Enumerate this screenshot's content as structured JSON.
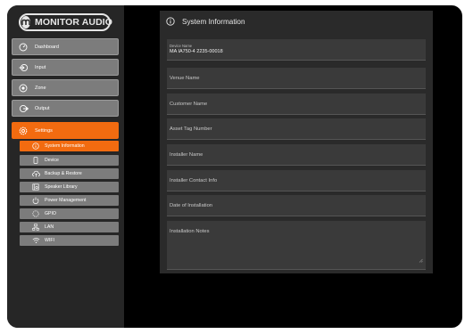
{
  "brand": {
    "name": "MONITOR AUDIO"
  },
  "nav": [
    {
      "label": "Dashboard",
      "icon": "dashboard-icon",
      "active": false
    },
    {
      "label": "Input",
      "icon": "input-icon",
      "active": false
    },
    {
      "label": "Zone",
      "icon": "zone-icon",
      "active": false
    },
    {
      "label": "Output",
      "icon": "output-icon",
      "active": false
    },
    {
      "label": "Settings",
      "icon": "gear-icon",
      "active": true
    }
  ],
  "settings_sub": [
    {
      "label": "System Information",
      "icon": "info-icon",
      "active": true
    },
    {
      "label": "Device",
      "icon": "device-icon",
      "active": false
    },
    {
      "label": "Backup & Restore",
      "icon": "cloud-icon",
      "active": false
    },
    {
      "label": "Speaker Library",
      "icon": "library-icon",
      "active": false
    },
    {
      "label": "Power Management",
      "icon": "power-icon",
      "active": false
    },
    {
      "label": "GPIO",
      "icon": "gpio-icon",
      "active": false
    },
    {
      "label": "LAN",
      "icon": "lan-icon",
      "active": false
    },
    {
      "label": "WIFI",
      "icon": "wifi-icon",
      "active": false
    }
  ],
  "panel": {
    "title": "System Information",
    "device_name_label": "Device Name",
    "device_name_value": "MA IA750-4 2235-00018",
    "fields": [
      "Venue Name",
      "Customer Name",
      "Asset Tag Number",
      "Installer Name",
      "Installer Contact Info",
      "Date of Installation"
    ],
    "notes_placeholder": "Installation Notes"
  },
  "colors": {
    "accent": "#f26b10",
    "sidebar": "#262626",
    "panel": "#2a2a2a",
    "field": "#3a3a3a"
  }
}
